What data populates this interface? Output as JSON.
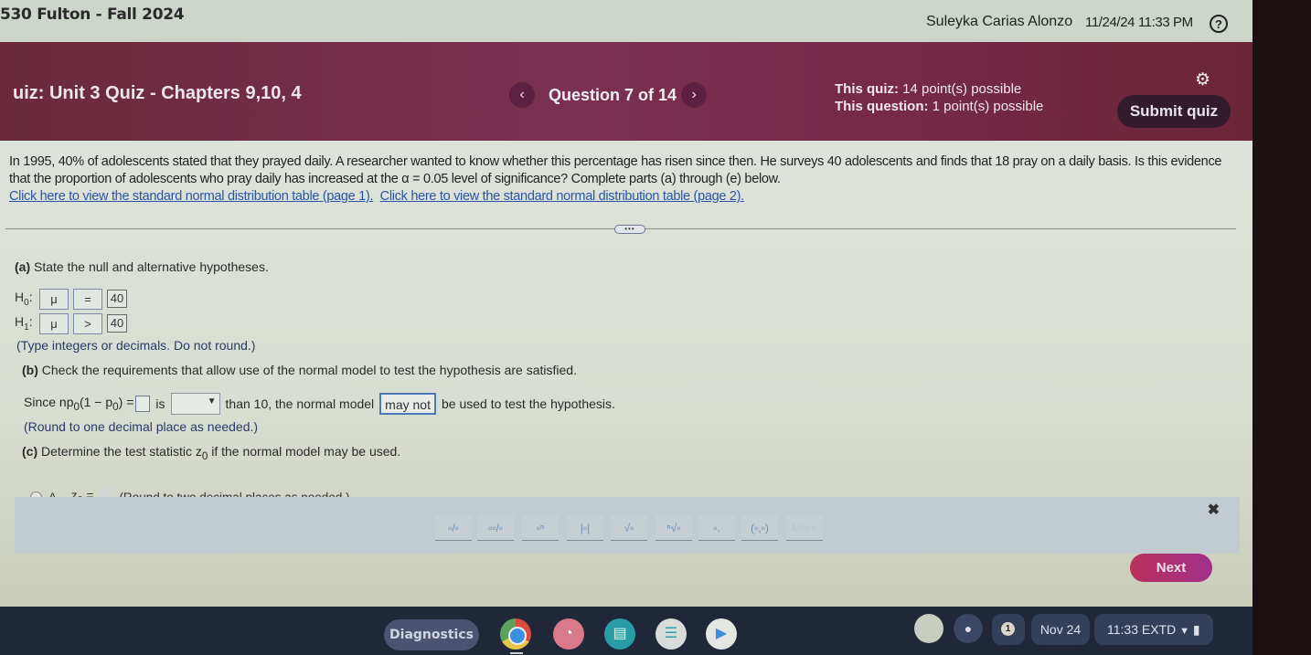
{
  "topbar": {
    "course_title": "530 Fulton - Fall 2024",
    "user_name": "Suleyka Carias Alonzo",
    "datetime": "11/24/24 11:33 PM",
    "help_icon": "?"
  },
  "quiz_header": {
    "quiz_title": "uiz:  Unit 3 Quiz - Chapters 9,10, 4",
    "prev_icon": "‹",
    "next_icon": "›",
    "question_counter": "Question 7 of 14",
    "quiz_points_label": "This quiz:",
    "quiz_points_value": " 14 point(s) possible",
    "question_points_label": "This question:",
    "question_points_value": " 1 point(s) possible",
    "settings_icon": "⚙",
    "submit_label": "Submit quiz"
  },
  "question": {
    "prompt": "In 1995, 40% of adolescents stated that they prayed daily. A researcher wanted to know whether this percentage has risen since then. He surveys 40 adolescents and finds that 18 pray on a daily basis. Is this evidence that the proportion of adolescents who pray daily has increased at the α = 0.05 level of significance? Complete parts (a) through (e) below.",
    "link_page1": "Click here to view the standard normal distribution table (page 1).",
    "link_page2": "Click here to view the standard normal distribution table (page 2).",
    "more_pill": "•••"
  },
  "part_a": {
    "label": "(a)",
    "text": " State the null and alternative hypotheses.",
    "h0": {
      "label": "H",
      "sub": "0",
      "param": "μ",
      "op": "=",
      "value": "40"
    },
    "h1": {
      "label": "H",
      "sub": "1",
      "param": "μ",
      "op": ">",
      "value": "40"
    },
    "note": "(Type integers or decimals. Do not round.)"
  },
  "part_b": {
    "label": "(b)",
    "text": " Check the requirements that allow use of the normal model to test the hypothesis are satisfied.",
    "since": "Since np",
    "sub0": "0",
    "paren": "(1 − p",
    "paren_sub": "0",
    "eq": ") =",
    "is": "is",
    "dropdown_value": "",
    "dropdown_arrow": "▼",
    "than": "than 10, the normal model",
    "answer": "may not",
    "tail": "be used to test the hypothesis.",
    "note": "(Round to one decimal place as needed.)"
  },
  "part_c": {
    "label": "(c)",
    "text_pre": " Determine the test statistic z",
    "text_sub": "0",
    "text_post": " if the normal model may be used.",
    "option_a_label": "A.",
    "option_a_var": "z",
    "option_a_sub": "0",
    "option_a_eq": "=",
    "option_a_note": "(Round to two decimal places as needed.)"
  },
  "palette": {
    "close_icon": "✖",
    "buttons": [
      "▫/▫",
      "▫▫/▫",
      "▫ⁿ",
      "|▫|",
      "√▫",
      "ⁿ√▫",
      "▫.",
      "(▫,▫)",
      "More"
    ]
  },
  "next_label": "Next",
  "shelf": {
    "diagnostics_label": "Diagnostics",
    "apps": [
      "chrome",
      "brain-app",
      "cards-app",
      "docs-app",
      "play-store"
    ],
    "notification_count": "1",
    "date": "Nov 24",
    "time": "11:33  EXTD",
    "wifi_icon": "▼",
    "battery_icon": "▮",
    "mic_icon": "🎙"
  }
}
